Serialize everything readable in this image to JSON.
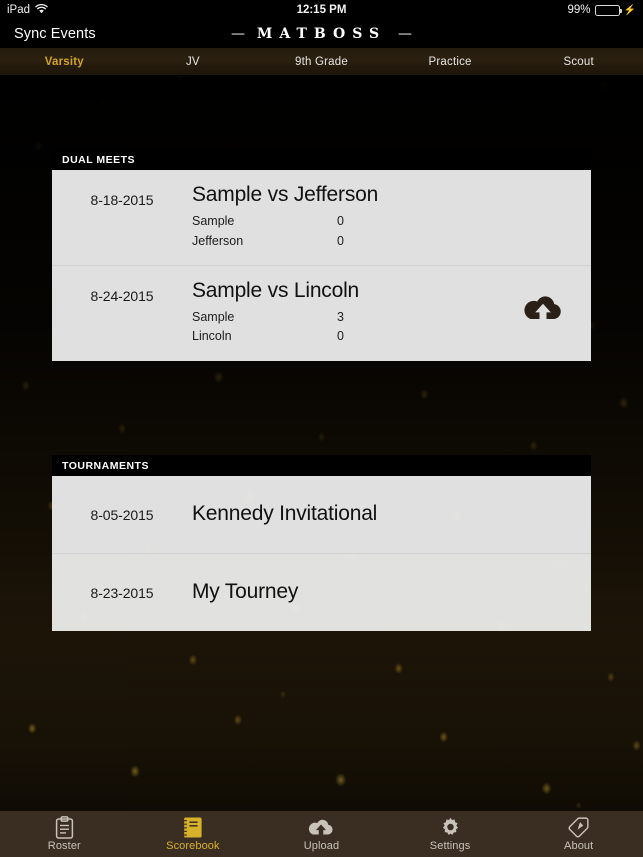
{
  "status_bar": {
    "device": "iPad",
    "wifi_icon": "wifi-icon",
    "time": "12:15 PM",
    "battery_percent": "99%",
    "battery_level": 99,
    "charging_icon": "lightning-bolt-icon"
  },
  "nav": {
    "sync_label": "Sync Events",
    "logo_left_dash": "—",
    "logo_text": "MATBOSS",
    "logo_right_dash": "—"
  },
  "tabs": [
    {
      "label": "Varsity",
      "active": true
    },
    {
      "label": "JV",
      "active": false
    },
    {
      "label": "9th Grade",
      "active": false
    },
    {
      "label": "Practice",
      "active": false
    },
    {
      "label": "Scout",
      "active": false
    }
  ],
  "sections": {
    "dual_meets": {
      "header": "DUAL MEETS",
      "rows": [
        {
          "date": "8-18-2015",
          "title": "Sample vs Jefferson",
          "scores": [
            {
              "team": "Sample",
              "value": "0"
            },
            {
              "team": "Jefferson",
              "value": "0"
            }
          ],
          "upload_icon": false
        },
        {
          "date": "8-24-2015",
          "title": "Sample vs Lincoln",
          "scores": [
            {
              "team": "Sample",
              "value": "3"
            },
            {
              "team": "Lincoln",
              "value": "0"
            }
          ],
          "upload_icon": true
        }
      ]
    },
    "tournaments": {
      "header": "TOURNAMENTS",
      "rows": [
        {
          "date": "8-05-2015",
          "title": "Kennedy Invitational"
        },
        {
          "date": "8-23-2015",
          "title": "My Tourney"
        }
      ]
    }
  },
  "tabbar": [
    {
      "label": "Roster",
      "icon": "clipboard-icon",
      "active": false
    },
    {
      "label": "Scorebook",
      "icon": "notebook-icon",
      "active": true
    },
    {
      "label": "Upload",
      "icon": "cloud-upload-icon",
      "active": false
    },
    {
      "label": "Settings",
      "icon": "gear-icon",
      "active": false
    },
    {
      "label": "About",
      "icon": "tag-icon",
      "active": false
    }
  ],
  "colors": {
    "accent_gold": "#d1a326",
    "tabbar_bg": "#3a2e22",
    "card_bg": "#eeeeee",
    "battery_green": "#4cd964"
  }
}
